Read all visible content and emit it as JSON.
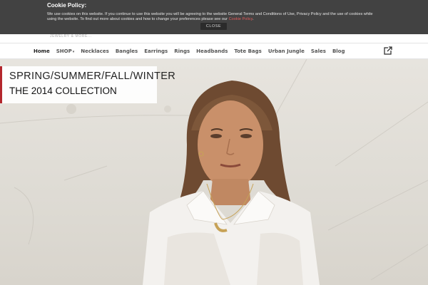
{
  "cookie": {
    "title": "Cookie Policy:",
    "text": "We use cookies on this website. If you continue to use this website you will be agreeing to the website General Terms and Conditions of Use, Privacy Policy and the use of cookies while using the website. To find out more about cookies and how to change your preferences please see our",
    "link": "Cookie Policy",
    "close_label": "CLOSE"
  },
  "header": {
    "tagline": "JEWELRY & MORE..."
  },
  "nav": {
    "items": [
      {
        "label": "Home",
        "active": true
      },
      {
        "label": "SHOP"
      },
      {
        "label": "Necklaces"
      },
      {
        "label": "Bangles"
      },
      {
        "label": "Earrings"
      },
      {
        "label": "Rings"
      },
      {
        "label": "Headbands"
      },
      {
        "label": "Tote Bags"
      },
      {
        "label": "Urban Jungle"
      },
      {
        "label": "Sales"
      },
      {
        "label": "Blog"
      }
    ],
    "share_icon": "external-share-icon"
  },
  "hero": {
    "line1": "SPRING/SUMMER/FALL/WINTER",
    "line2": "THE 2014 COLLECTION",
    "accent_color": "#b3262c"
  }
}
